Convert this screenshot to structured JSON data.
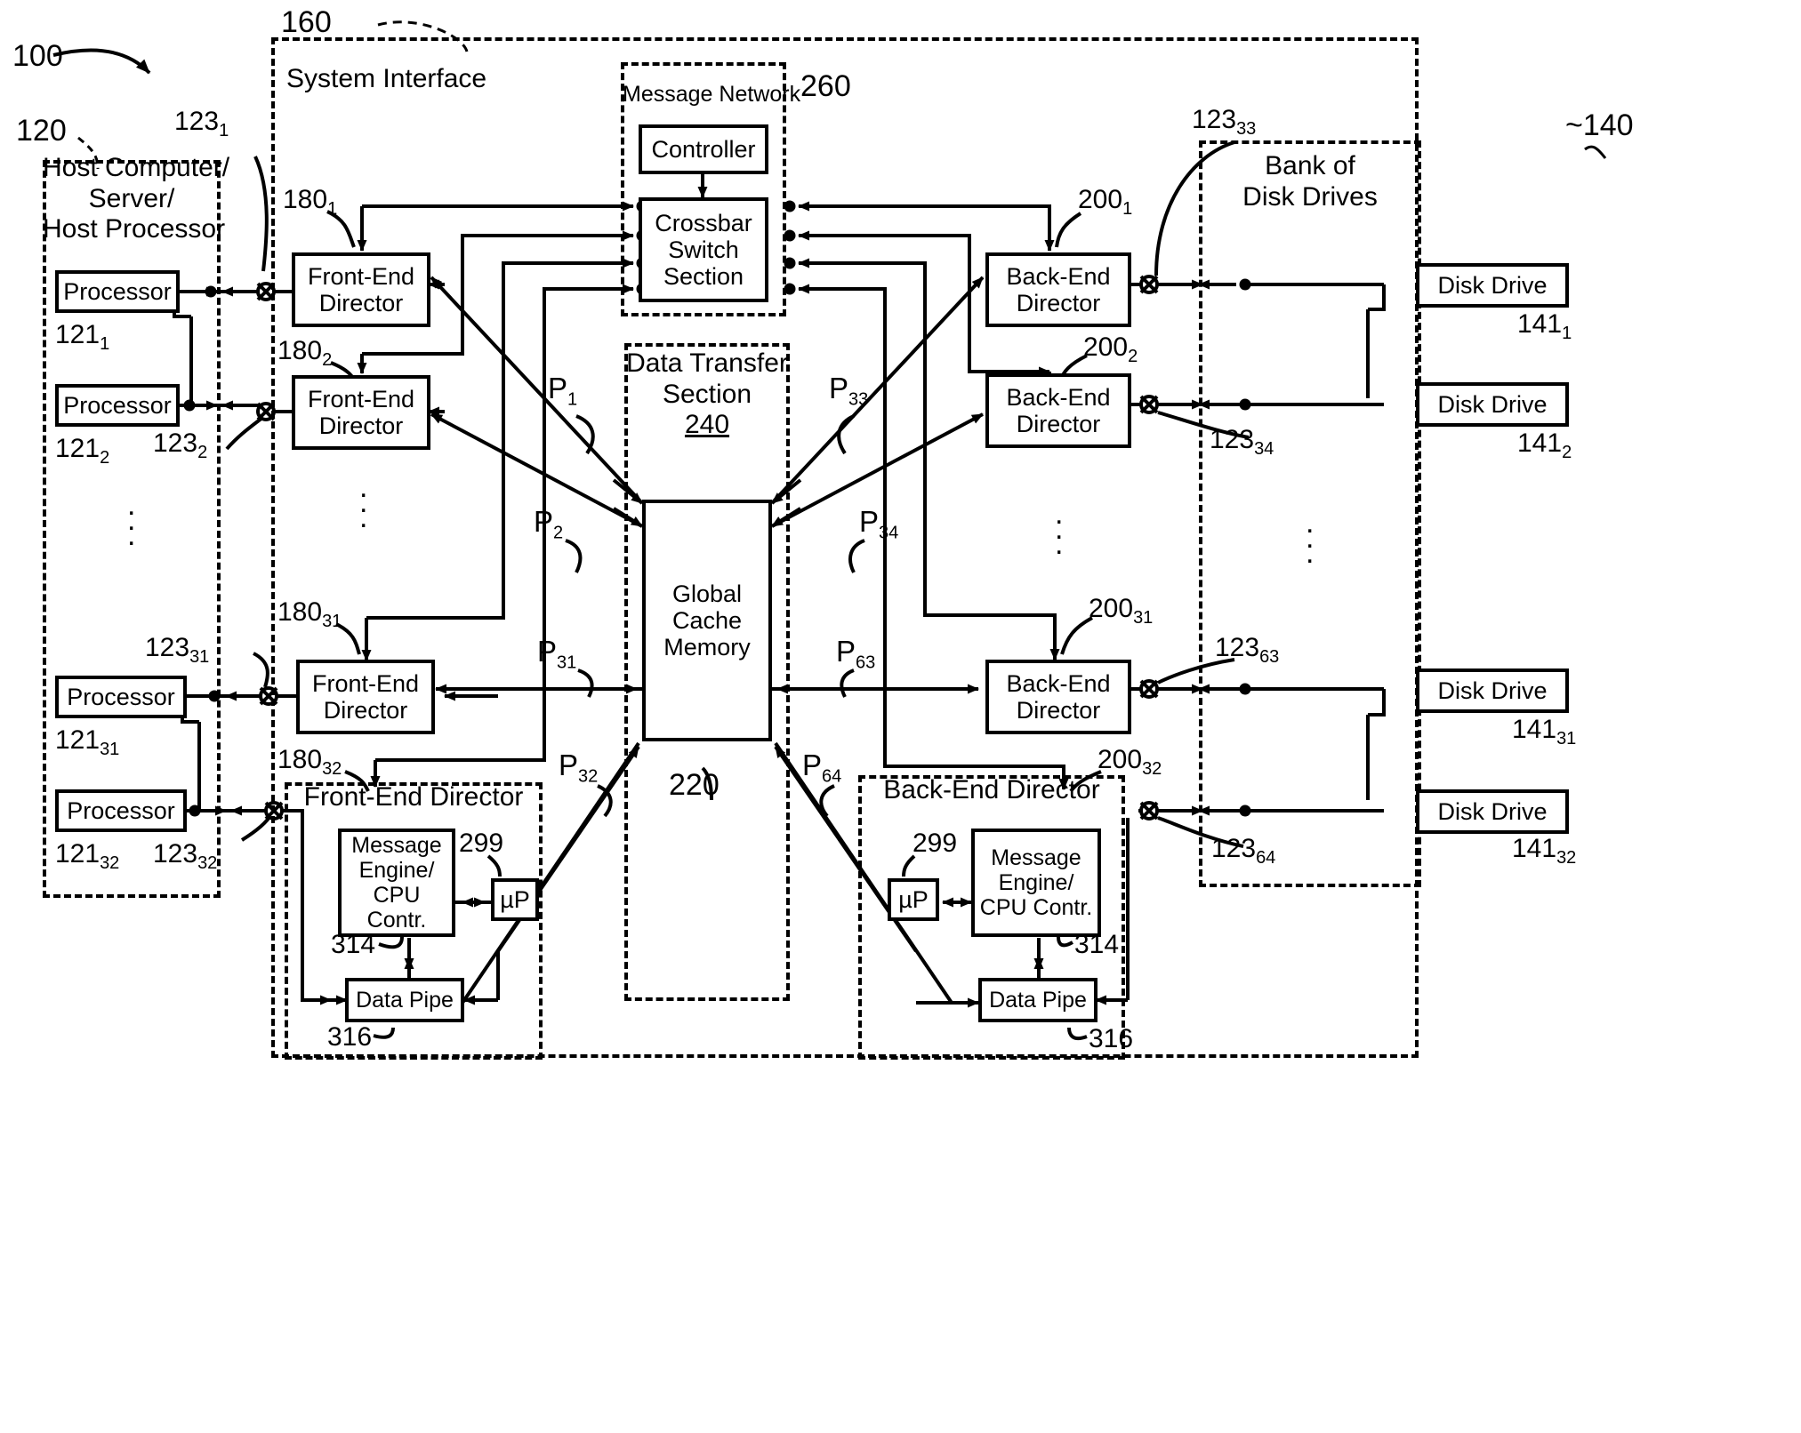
{
  "figure": {
    "system_ref": "100",
    "system_interface": {
      "label": "System Interface",
      "ref": "160"
    },
    "host": {
      "ref": "120",
      "title_lines": [
        "Host Computer/",
        "Server/",
        "Host Processor"
      ],
      "processors": [
        {
          "label": "Processor",
          "ref_base": "121",
          "ref_sub": "1",
          "link_base": "123",
          "link_sub": "1"
        },
        {
          "label": "Processor",
          "ref_base": "121",
          "ref_sub": "2",
          "link_base": "123",
          "link_sub": "2"
        },
        {
          "label": "Processor",
          "ref_base": "121",
          "ref_sub": "31",
          "link_base": "123",
          "link_sub": "31"
        },
        {
          "label": "Processor",
          "ref_base": "121",
          "ref_sub": "32",
          "link_base": "123",
          "link_sub": "32"
        }
      ]
    },
    "message_network": {
      "label": "Message Network",
      "ref": "260",
      "controller": "Controller",
      "crossbar_lines": [
        "Crossbar",
        "Switch",
        "Section"
      ]
    },
    "data_transfer": {
      "label_lines": [
        "Data Transfer",
        "Section"
      ],
      "ref": "240",
      "cache_lines": [
        "Global",
        "Cache",
        "Memory"
      ],
      "cache_ref": "220"
    },
    "front_end_directors": [
      {
        "lines": [
          "Front-End",
          "Director"
        ],
        "ref_base": "180",
        "ref_sub": "1"
      },
      {
        "lines": [
          "Front-End",
          "Director"
        ],
        "ref_base": "180",
        "ref_sub": "2"
      },
      {
        "lines": [
          "Front-End",
          "Director"
        ],
        "ref_base": "180",
        "ref_sub": "31"
      },
      {
        "lines": [
          "Front-End Director"
        ],
        "ref_base": "180",
        "ref_sub": "32"
      }
    ],
    "back_end_directors": [
      {
        "lines": [
          "Back-End",
          "Director"
        ],
        "ref_base": "200",
        "ref_sub": "1"
      },
      {
        "lines": [
          "Back-End",
          "Director"
        ],
        "ref_base": "200",
        "ref_sub": "2"
      },
      {
        "lines": [
          "Back-End",
          "Director"
        ],
        "ref_base": "200",
        "ref_sub": "31"
      },
      {
        "lines": [
          "Back-End Director"
        ],
        "ref_base": "200",
        "ref_sub": "32"
      }
    ],
    "director_detail": {
      "front_title": "Front-End Director",
      "back_title": "Back-End Director",
      "message_engine_lines": [
        "Message",
        "Engine/",
        "CPU Contr."
      ],
      "message_engine_ref": "314",
      "microprocessor": "µP",
      "microprocessor_ref": "299",
      "data_pipe": "Data Pipe",
      "data_pipe_ref": "316"
    },
    "disk_bank": {
      "ref": "140",
      "title_lines": [
        "Bank of",
        "Disk Drives"
      ],
      "drives": [
        {
          "label": "Disk Drive",
          "ref_base": "141",
          "ref_sub": "1",
          "link_base": "123",
          "link_sub": "33"
        },
        {
          "label": "Disk Drive",
          "ref_base": "141",
          "ref_sub": "2",
          "link_base": "123",
          "link_sub": "34"
        },
        {
          "label": "Disk Drive",
          "ref_base": "141",
          "ref_sub": "31",
          "link_base": "123",
          "link_sub": "63"
        },
        {
          "label": "Disk Drive",
          "ref_base": "141",
          "ref_sub": "32",
          "link_base": "123",
          "link_sub": "64"
        }
      ]
    },
    "port_labels": [
      {
        "base": "P",
        "sub": "1"
      },
      {
        "base": "P",
        "sub": "2"
      },
      {
        "base": "P",
        "sub": "31"
      },
      {
        "base": "P",
        "sub": "32"
      },
      {
        "base": "P",
        "sub": "33"
      },
      {
        "base": "P",
        "sub": "34"
      },
      {
        "base": "P",
        "sub": "63"
      },
      {
        "base": "P",
        "sub": "64"
      }
    ],
    "colors": {
      "ink": "#000000",
      "paper": "#ffffff"
    }
  }
}
